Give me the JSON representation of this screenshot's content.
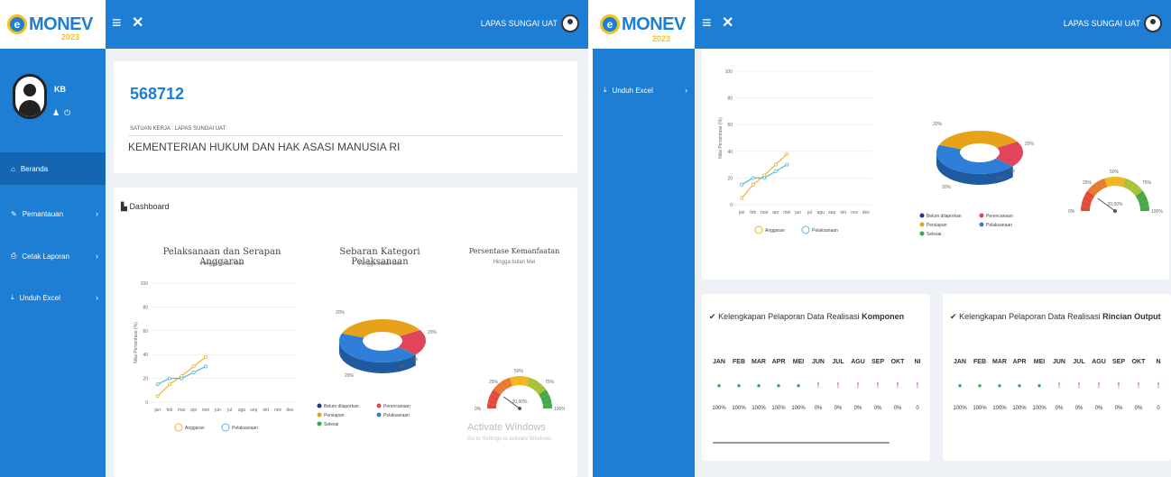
{
  "left": {
    "brand": {
      "name": "MONEV",
      "year": "2023"
    },
    "topbar": {
      "menu_icon": "hamburger-icon",
      "close_icon": "x-icon",
      "user_label": "LAPAS SUNGAI UAT"
    },
    "profile": {
      "name": "KB"
    },
    "nav": [
      {
        "label": "Beranda",
        "icon": "home-icon",
        "active": true
      },
      {
        "label": "Pemantauan",
        "icon": "pencil-icon",
        "active": false
      },
      {
        "label": "Cetak Laporan",
        "icon": "print-icon",
        "active": false
      },
      {
        "label": "Unduh Excel",
        "icon": "download-icon",
        "active": false
      }
    ],
    "info": {
      "code": "568712",
      "satker_label": "SATUAN KERJA : LAPAS SUNGAI UAT",
      "ministry": "KEMENTERIAN HUKUM DAN HAK ASASI MANUSIA RI"
    },
    "dashboard_label": "Dashboard",
    "watermark": {
      "line1": "Activate Windows",
      "line2": "Go to Settings to activate Windows."
    }
  },
  "right": {
    "brand": {
      "name": "MONEV",
      "year": "2023"
    },
    "topbar": {
      "menu_icon": "hamburger-icon",
      "close_icon": "x-icon",
      "user_label": "LAPAS SUNGAI UAT"
    },
    "nav": [
      {
        "label": "Unduh Excel",
        "icon": "download-icon"
      }
    ],
    "komponen": {
      "prefix": "Kelengkapan Pelaporan Data Realisasi ",
      "bold": "Komponen",
      "months": [
        "JAN",
        "FEB",
        "MAR",
        "APR",
        "MEI",
        "JUN",
        "JUL",
        "AGU",
        "SEP",
        "OKT",
        "NI"
      ],
      "status": [
        "ok",
        "ok",
        "ok",
        "ok",
        "ok",
        "bad",
        "bad",
        "bad",
        "bad",
        "bad",
        "bad"
      ],
      "percent": [
        "100%",
        "100%",
        "100%",
        "100%",
        "100%",
        "0%",
        "0%",
        "0%",
        "0%",
        "0%",
        "0"
      ]
    },
    "rincian": {
      "prefix": "Kelengkapan Pelaporan Data Realisasi ",
      "bold": "Rincian Output",
      "months": [
        "JAN",
        "FEB",
        "MAR",
        "APR",
        "MEI",
        "JUN",
        "JUL",
        "AGU",
        "SEP",
        "OKT",
        "N"
      ],
      "status": [
        "ok",
        "ok",
        "ok",
        "ok",
        "ok",
        "bad",
        "bad",
        "bad",
        "bad",
        "bad",
        "bad"
      ],
      "percent": [
        "100%",
        "100%",
        "100%",
        "100%",
        "100%",
        "0%",
        "0%",
        "0%",
        "0%",
        "0%",
        "0"
      ]
    }
  },
  "chart_data": [
    {
      "type": "line",
      "title": "Pelaksanaan dan Serapan Anggaran",
      "subtitle": "Hingga bulan Mei",
      "ylabel": "Nilai Persentase (%)",
      "categories": [
        "jan",
        "feb",
        "mar",
        "apr",
        "mei",
        "jun",
        "jul",
        "agu",
        "sep",
        "okt",
        "nov",
        "des"
      ],
      "ylim": [
        0,
        100
      ],
      "yticks": [
        "0",
        "20",
        "40",
        "60",
        "80",
        "100"
      ],
      "series": [
        {
          "name": "Anggaran",
          "color": "#f0b429",
          "values": [
            5,
            15,
            22,
            30,
            38
          ]
        },
        {
          "name": "Pelaksanaan",
          "color": "#54b8de",
          "values": [
            15,
            20,
            20,
            25,
            30
          ]
        }
      ]
    },
    {
      "type": "pie",
      "title": "Sebaran Kategori Pelaksanaan",
      "subtitle": "Hingga bulan Mei",
      "slice_labels": [
        "20%",
        "20%",
        "20%",
        "0%",
        "0%"
      ],
      "legend": [
        {
          "name": "Belum dilaporkan",
          "color": "#1f3c7a"
        },
        {
          "name": "Perencanaan",
          "color": "#e0455c"
        },
        {
          "name": "Persiapan",
          "color": "#e8a21a"
        },
        {
          "name": "Pelaksanaan",
          "color": "#2f7fd9"
        },
        {
          "name": "Selesai",
          "color": "#33a852"
        }
      ]
    },
    {
      "type": "gauge",
      "title": "Persentase Kemanfaatan",
      "subtitle": "Hingga bulan Mei",
      "value_label": "20,00%",
      "ticks": [
        "0%",
        "25%",
        "50%",
        "75%",
        "100%"
      ]
    }
  ]
}
